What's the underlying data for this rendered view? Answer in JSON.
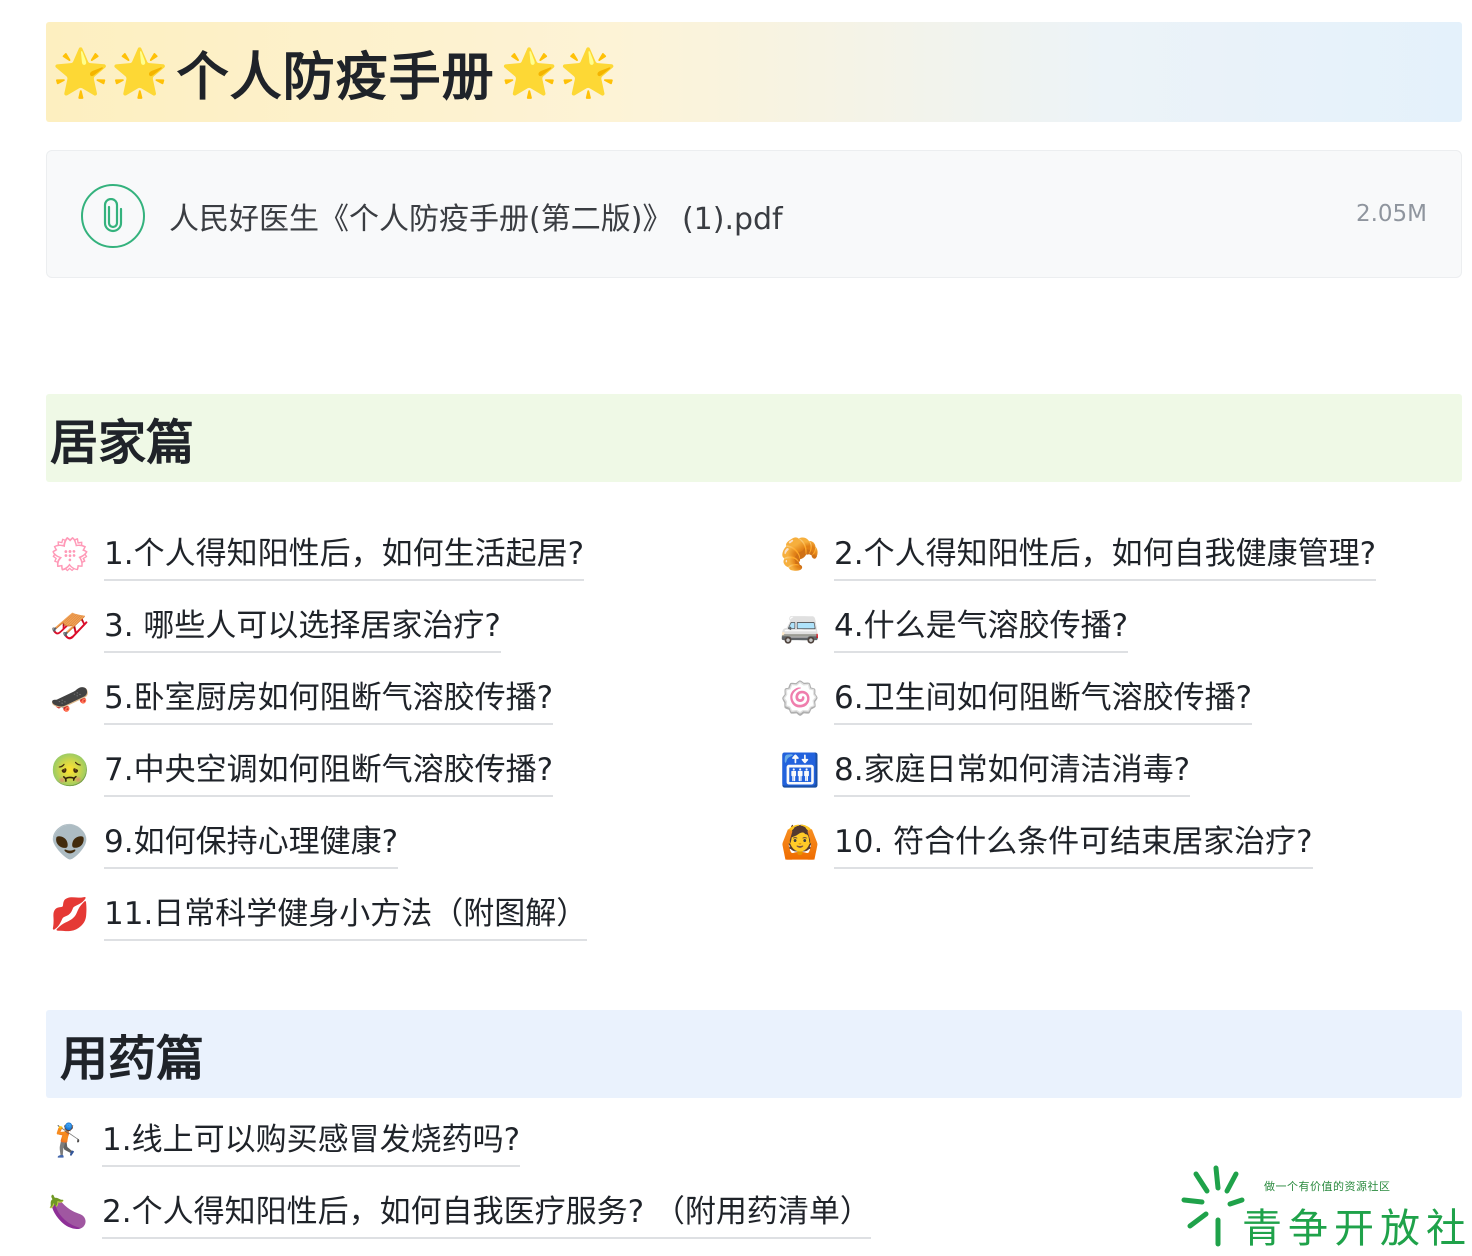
{
  "header": {
    "title": "个人防疫手册",
    "stars_left": "🌟🌟",
    "stars_right": "🌟🌟"
  },
  "attachment": {
    "icon": "paperclip-icon",
    "file_name": "人民好医生《个人防疫手册(第二版)》 (1).pdf",
    "file_size": "2.05M"
  },
  "sections": {
    "home": {
      "title": "居家篇",
      "items": [
        {
          "emoji": "💮",
          "label": "1.个人得知阳性后，如何生活起居?"
        },
        {
          "emoji": "🥐",
          "label": "2.个人得知阳性后，如何自我健康管理?"
        },
        {
          "emoji": "🛷",
          "label": "3. 哪些人可以选择居家治疗?"
        },
        {
          "emoji": "🚐",
          "label": "4.什么是气溶胶传播?"
        },
        {
          "emoji": "🛹",
          "label": "5.卧室厨房如何阻断气溶胶传播?"
        },
        {
          "emoji": "🍥",
          "label": "6.卫生间如何阻断气溶胶传播?"
        },
        {
          "emoji": "🤢",
          "label": "7.中央空调如何阻断气溶胶传播?"
        },
        {
          "emoji": "🛗",
          "label": "8.家庭日常如何清洁消毒?"
        },
        {
          "emoji": "👽",
          "label": "9.如何保持心理健康?"
        },
        {
          "emoji": "🙆",
          "label": "10. 符合什么条件可结束居家治疗?"
        },
        {
          "emoji": "💋",
          "label": "11.日常科学健身小方法（附图解）"
        }
      ]
    },
    "medication": {
      "title": "用药篇",
      "items": [
        {
          "emoji": "🏌",
          "label": "1.线上可以购买感冒发烧药吗?"
        },
        {
          "emoji": "🍆",
          "label": "2.个人得知阳性后，如何自我医疗服务? （附用药清单）"
        }
      ]
    }
  },
  "watermark": {
    "tagline": "做一个有价值的资源社区",
    "brand": "青争开放社区",
    "color": "#1fa24a"
  }
}
